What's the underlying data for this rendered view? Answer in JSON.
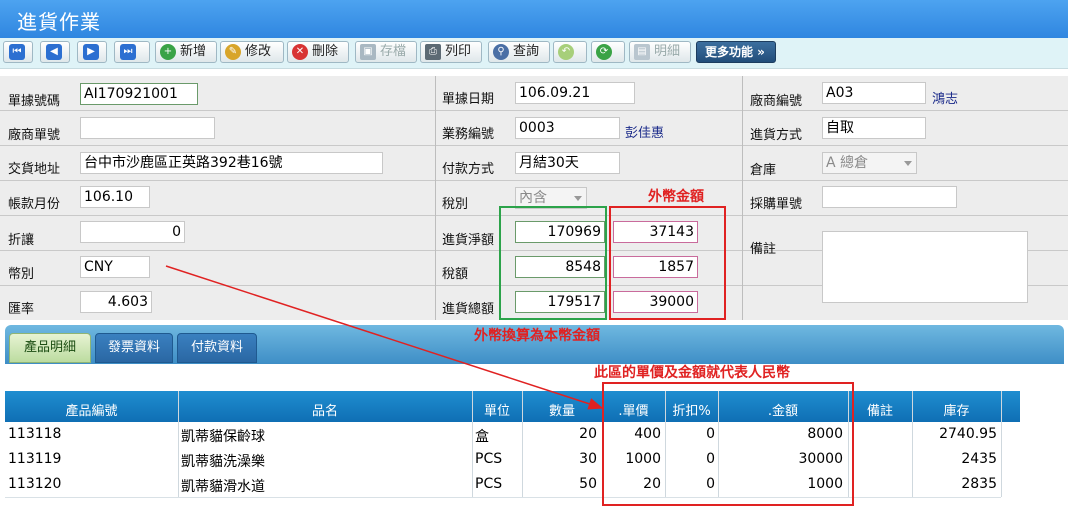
{
  "window": {
    "title": "進貨作業"
  },
  "toolbar": {
    "add": "新增",
    "edit": "修改",
    "delete": "刪除",
    "save": "存檔",
    "print": "列印",
    "query": "查詢",
    "detail": "明細",
    "more": "更多功能 »"
  },
  "form": {
    "doc_no_label": "單據號碼",
    "doc_no": "AI170921001",
    "doc_date_label": "單據日期",
    "doc_date": "106.09.21",
    "vendor_code_label": "廠商編號",
    "vendor_code": "A03",
    "vendor_name": "鴻志",
    "vendor_doc_label": "廠商單號",
    "vendor_doc": "",
    "sales_code_label": "業務編號",
    "sales_code": "0003",
    "sales_name": "彭佳惠",
    "purchase_method_label": "進貨方式",
    "purchase_method": "自取",
    "address_label": "交貨地址",
    "address": "台中市沙鹿區正英路392巷16號",
    "payment_label": "付款方式",
    "payment": "月結30天",
    "warehouse_label": "倉庫",
    "warehouse": "A 總倉",
    "account_month_label": "帳款月份",
    "account_month": "106.10",
    "tax_label": "稅別",
    "tax": "內含",
    "po_no_label": "採購單號",
    "po_no": "",
    "discount_label": "折讓",
    "discount": "0",
    "net_label": "進貨淨額",
    "net_local": "170969",
    "net_foreign": "37143",
    "remark_label": "備註",
    "remark": "",
    "currency_label": "幣別",
    "currency": "CNY",
    "tax_amount_label": "稅額",
    "tax_local": "8548",
    "tax_foreign": "1857",
    "rate_label": "匯率",
    "rate": "4.603",
    "total_label": "進貨總額",
    "total_local": "179517",
    "total_foreign": "39000"
  },
  "tabs": [
    "產品明細",
    "發票資料",
    "付款資料"
  ],
  "table": {
    "headers": [
      "產品編號",
      "品名",
      "單位",
      "數量",
      ".單價",
      "折扣%",
      ".金額",
      "備註",
      "庫存"
    ],
    "rows": [
      [
        "113118",
        "凱蒂貓保齡球",
        "盒",
        "20",
        "400",
        "0",
        "8000",
        "",
        "2740.95"
      ],
      [
        "113119",
        "凱蒂貓洗澡樂",
        "PCS",
        "30",
        "1000",
        "0",
        "30000",
        "",
        "2435"
      ],
      [
        "113120",
        "凱蒂貓滑水道",
        "PCS",
        "50",
        "20",
        "0",
        "1000",
        "",
        "2835"
      ]
    ]
  },
  "annotations": {
    "foreign_amount": "外幣金額",
    "converted": "外幣換算為本幣金額",
    "rmb_note": "此區的單價及金額就代表人民幣"
  },
  "colors": {
    "accent_red": "#e02222",
    "accent_green": "#2ca34a",
    "title_blue": "#2f86e0"
  }
}
